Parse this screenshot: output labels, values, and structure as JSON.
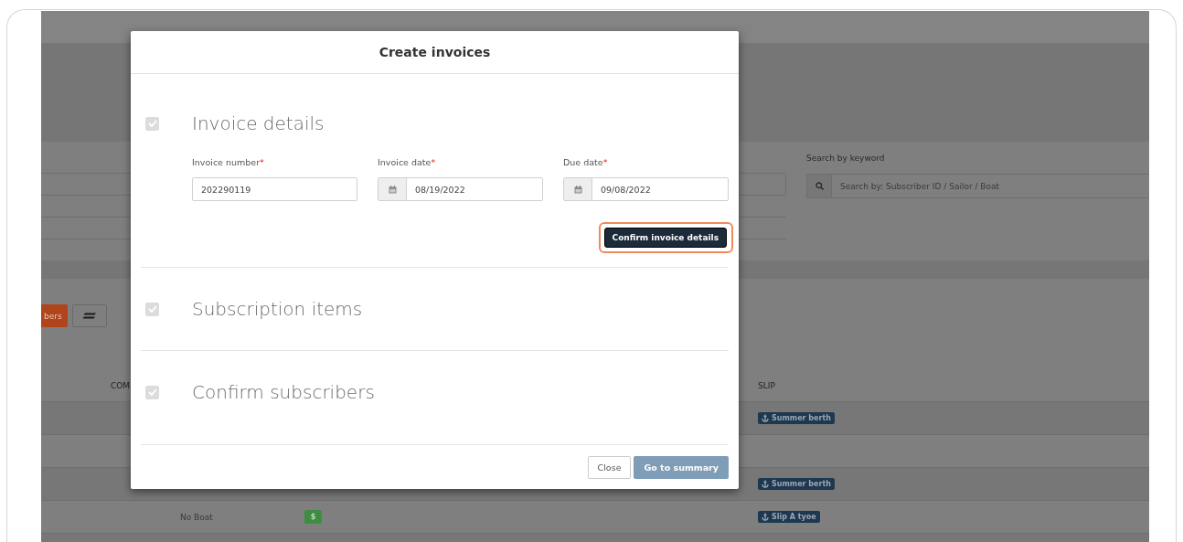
{
  "background": {
    "search": {
      "label": "Search by keyword",
      "placeholder": "Search by: Subscriber ID / Sailor / Boat"
    },
    "toolbar": {
      "primary_button": "bers"
    },
    "table": {
      "columns": [
        "COM",
        "SLIP"
      ],
      "rows": [
        {
          "slip": "Summer berth"
        },
        {},
        {
          "slip": "Summer berth"
        },
        {
          "boat": "No Boat",
          "payment": {
            "label": "$",
            "color": "#3e8e41"
          },
          "slip": "Slip A tyoe"
        }
      ]
    }
  },
  "dialog": {
    "title": "Create invoices",
    "steps": [
      {
        "title": "Invoice details",
        "checked": true,
        "fields": [
          {
            "label": "Invoice number",
            "required_mark": "*",
            "value": "202290119",
            "kind": "text"
          },
          {
            "label": "Invoice date",
            "required_mark": "*",
            "value": "08/19/2022",
            "kind": "date"
          },
          {
            "label": "Due date",
            "required_mark": "*",
            "value": "09/08/2022",
            "kind": "date"
          }
        ],
        "button": {
          "label": "Confirm invoice details",
          "highlighted": true
        }
      },
      {
        "title": "Subscription items",
        "checked": true
      },
      {
        "title": "Confirm subscribers",
        "checked": true
      }
    ],
    "buttons": [
      {
        "label": "Close",
        "kind": "secondary"
      },
      {
        "label": "Go to summary",
        "kind": "primary"
      }
    ]
  }
}
